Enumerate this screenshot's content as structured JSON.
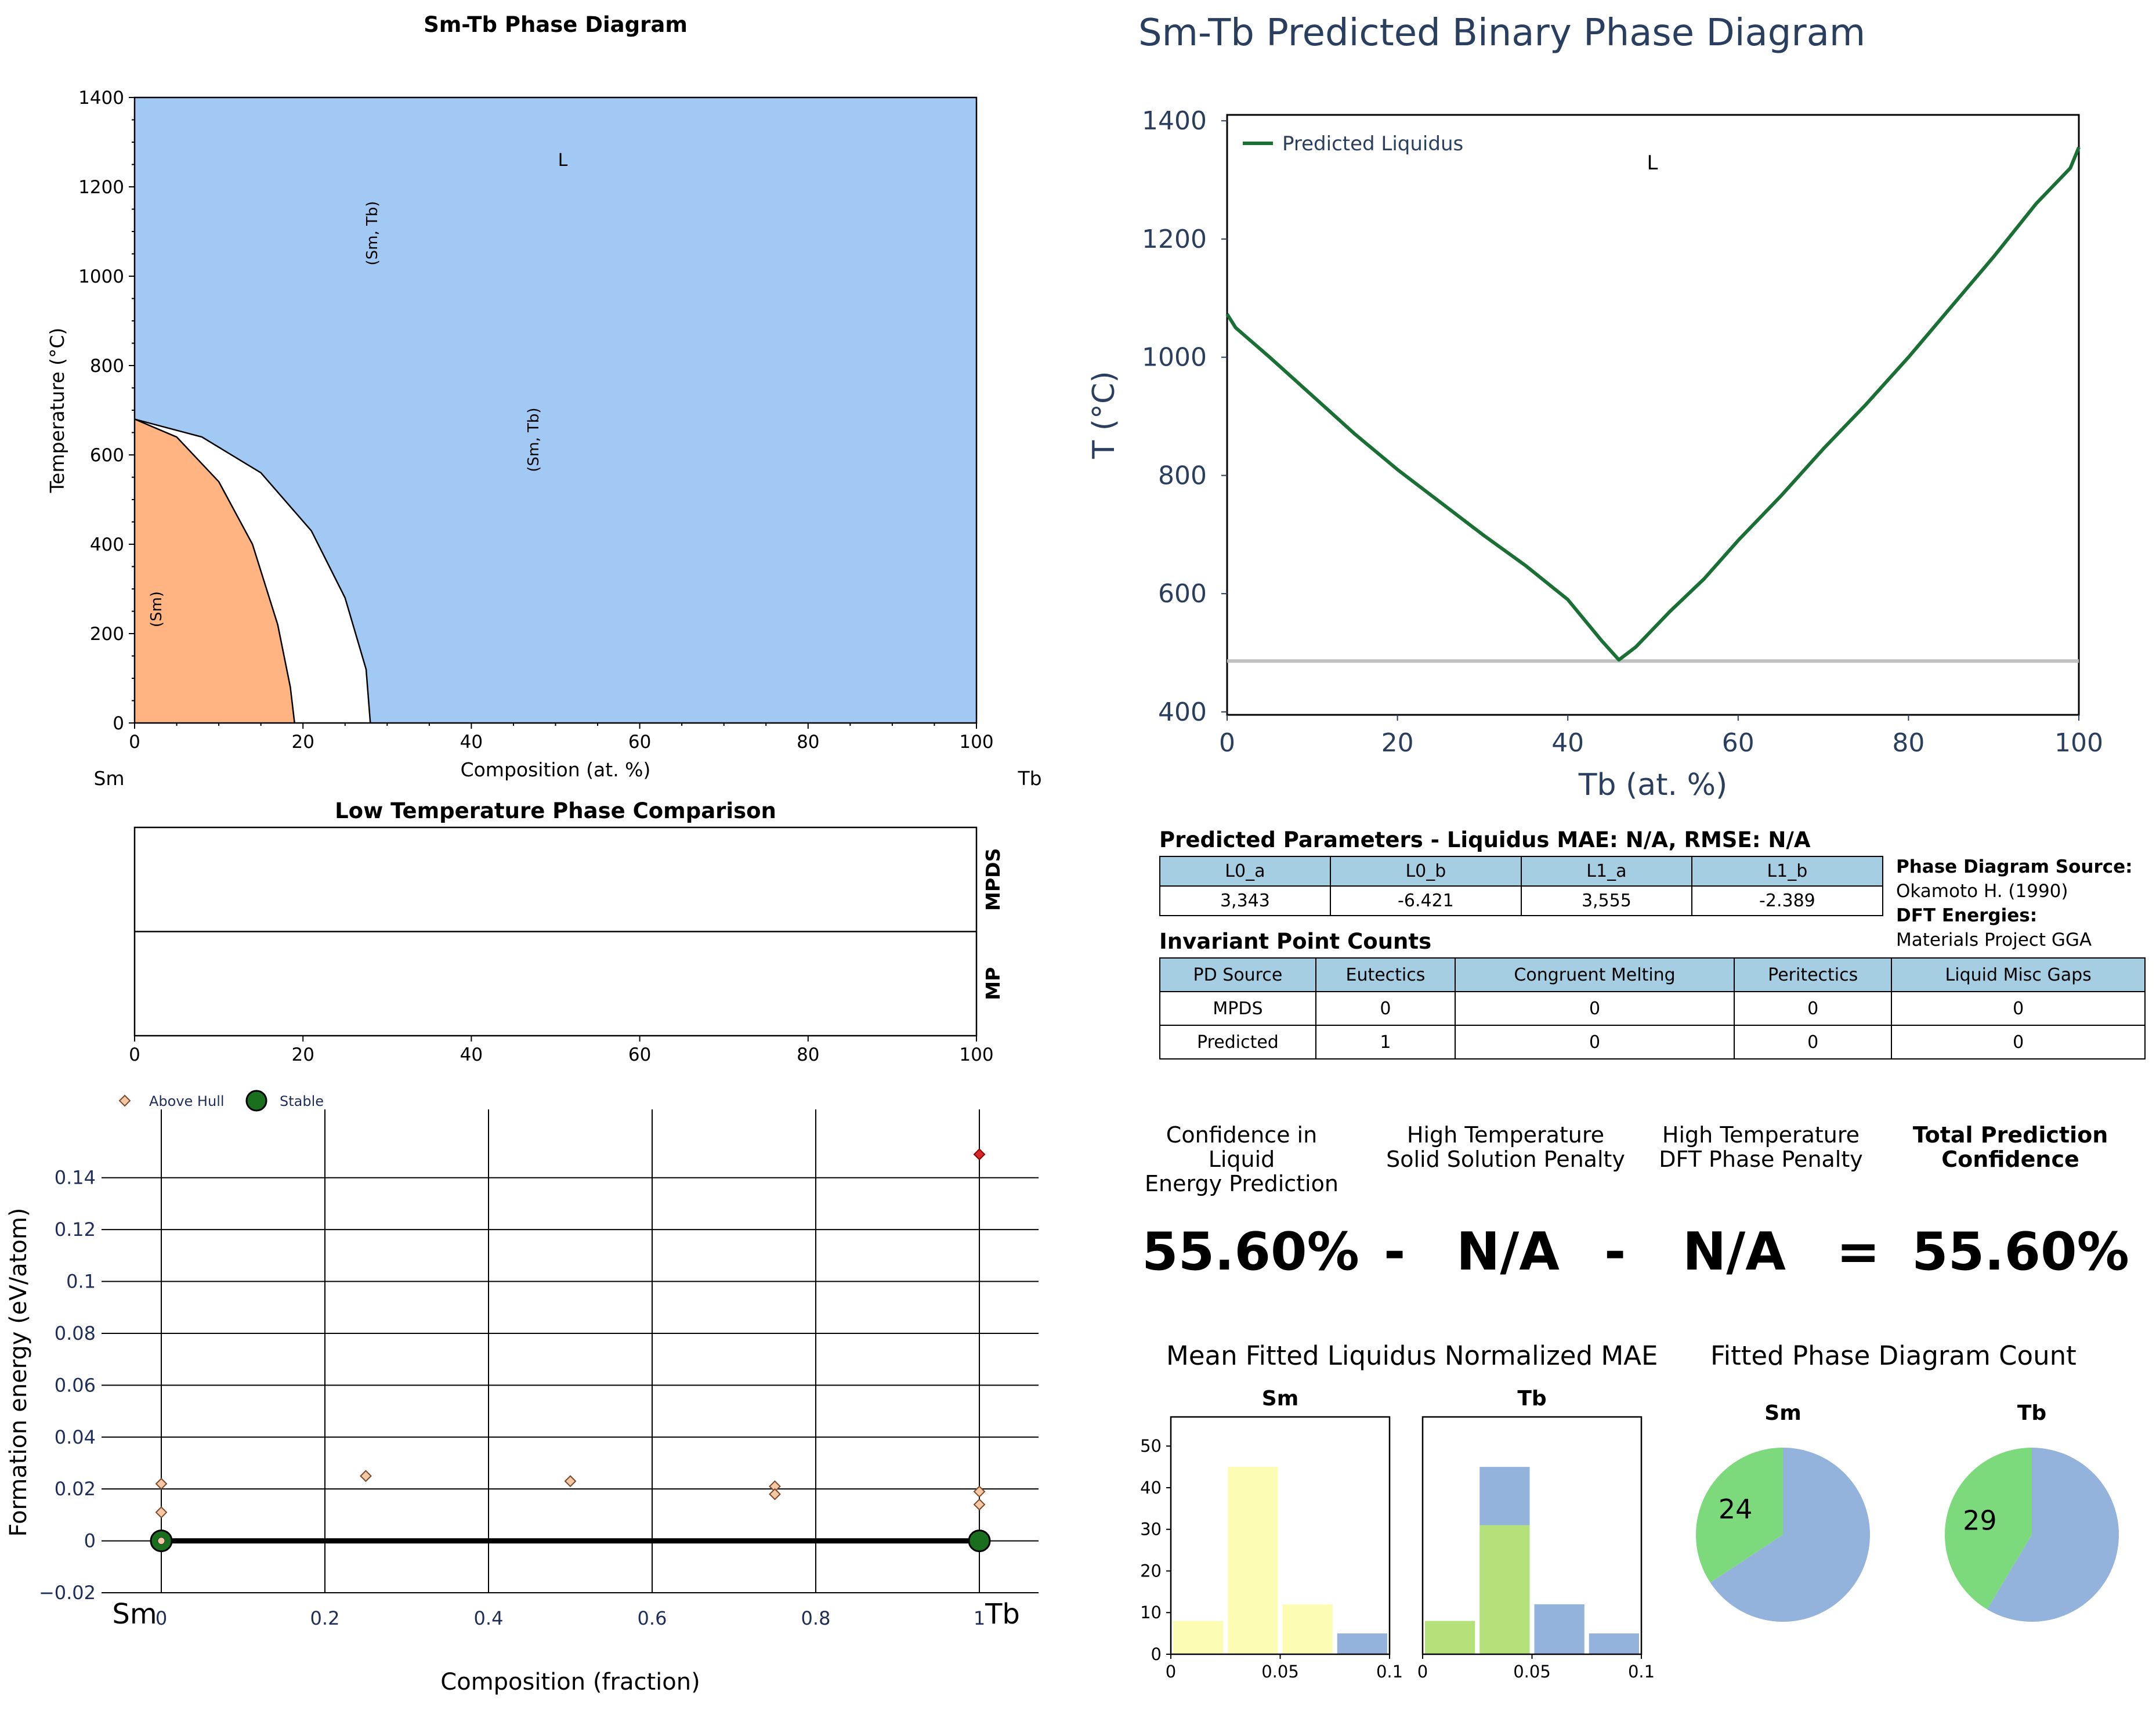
{
  "chart_data": [
    {
      "type": "area",
      "title": "Sm-Tb Phase Diagram",
      "xlabel": "Composition (at. %)",
      "ylabel": "Temperature (°C)",
      "xlim": [
        0,
        100
      ],
      "ylim": [
        0,
        1400
      ],
      "x_ticks": [
        "0",
        "20",
        "40",
        "60",
        "80",
        "100"
      ],
      "y_ticks": [
        "0",
        "200",
        "400",
        "600",
        "800",
        "1000",
        "1200",
        "1400"
      ],
      "left_element": "Sm",
      "right_element": "Tb",
      "regions": [
        {
          "label": "L",
          "color": "#a1c9f4"
        },
        {
          "label": "(Sm, Tb)",
          "color": "#a1c9f4"
        },
        {
          "label": "(Sm, Tb)",
          "color": "#a1c9f4"
        },
        {
          "label": "(Sm)",
          "color": "#ffb482"
        }
      ],
      "boundaries": [
        {
          "name": "solvus-1",
          "points": [
            [
              0,
              680
            ],
            [
              5,
              640
            ],
            [
              10,
              540
            ],
            [
              14,
              400
            ],
            [
              17,
              220
            ],
            [
              18.5,
              80
            ],
            [
              19,
              0
            ]
          ]
        },
        {
          "name": "solvus-2",
          "points": [
            [
              0,
              680
            ],
            [
              8,
              640
            ],
            [
              15,
              560
            ],
            [
              21,
              430
            ],
            [
              25,
              280
            ],
            [
              27.5,
              120
            ],
            [
              28,
              0
            ]
          ]
        }
      ]
    },
    {
      "type": "bar",
      "title": "Low Temperature Phase Comparison",
      "rows": [
        "MPDS",
        "MP"
      ],
      "xlim": [
        0,
        100
      ],
      "x_ticks": [
        "0",
        "20",
        "40",
        "60",
        "80",
        "100"
      ]
    },
    {
      "type": "scatter",
      "xlabel": "Composition (fraction)",
      "ylabel": "Formation energy (eV/atom)",
      "xlim": [
        0,
        1
      ],
      "ylim": [
        -0.02,
        0.15
      ],
      "x_ticks": [
        "0",
        "0.2",
        "0.4",
        "0.6",
        "0.8",
        "1"
      ],
      "y_ticks": [
        "−0.02",
        "0",
        "0.02",
        "0.04",
        "0.06",
        "0.08",
        "0.1",
        "0.12",
        "0.14"
      ],
      "left_element": "Sm",
      "right_element": "Tb",
      "legend": [
        {
          "name": "Above Hull"
        },
        {
          "name": "Stable"
        }
      ],
      "series": [
        {
          "name": "Above Hull",
          "color": "#f6c7a5",
          "points": [
            [
              0,
              0.022
            ],
            [
              0,
              0.011
            ],
            [
              0.25,
              0.025
            ],
            [
              0.5,
              0.023
            ],
            [
              0.75,
              0.021
            ],
            [
              0.75,
              0.018
            ],
            [
              1,
              0.019
            ],
            [
              1,
              0.014
            ],
            [
              1,
              0.149
            ]
          ]
        },
        {
          "name": "Stable",
          "color": "#1a6f1f",
          "points": [
            [
              0,
              0
            ],
            [
              1,
              0
            ]
          ]
        }
      ],
      "hull": [
        [
          0,
          0
        ],
        [
          1,
          0
        ]
      ]
    },
    {
      "type": "line",
      "title": "Sm-Tb Predicted Binary Phase Diagram",
      "xlabel": "Tb (at. %)",
      "ylabel": "T (°C)",
      "xlim": [
        0,
        100
      ],
      "ylim": [
        395,
        1410
      ],
      "x_ticks": [
        "0",
        "20",
        "40",
        "60",
        "80",
        "100"
      ],
      "y_ticks": [
        "400",
        "600",
        "800",
        "1000",
        "1200",
        "1400"
      ],
      "annotation": "L",
      "series": [
        {
          "name": "Predicted Liquidus",
          "color": "#1a6f35",
          "x": [
            0,
            1,
            5,
            10,
            15,
            20,
            25,
            30,
            35,
            40,
            44,
            46,
            48,
            52,
            56,
            60,
            65,
            70,
            75,
            80,
            85,
            90,
            95,
            99,
            100
          ],
          "y": [
            1073,
            1050,
            1000,
            935,
            870,
            810,
            755,
            700,
            648,
            590,
            520,
            488,
            510,
            570,
            625,
            690,
            765,
            845,
            920,
            1000,
            1085,
            1170,
            1260,
            1320,
            1355
          ]
        },
        {
          "name": "eutectic",
          "color": "#c0c0c0",
          "x": [
            0,
            100
          ],
          "y": [
            486,
            486
          ]
        }
      ]
    },
    {
      "type": "bar",
      "title": "Sm",
      "group_title": "Mean Fitted Liquidus Normalized MAE",
      "xlim": [
        0,
        0.1
      ],
      "ylim": [
        0,
        57
      ],
      "x_ticks": [
        "0",
        "0.05",
        "0.1"
      ],
      "y_ticks": [
        "0",
        "10",
        "20",
        "30",
        "40",
        "50"
      ],
      "bars": [
        {
          "x0": 0,
          "x1": 0.025,
          "value": 8,
          "color": "#fcfcb4"
        },
        {
          "x0": 0.025,
          "x1": 0.05,
          "value": 45,
          "color": "#fcfcb4"
        },
        {
          "x0": 0.05,
          "x1": 0.075,
          "value": 12,
          "color": "#fcfcb4"
        },
        {
          "x0": 0.075,
          "x1": 0.1,
          "value": 5,
          "color": "#93b2dc"
        }
      ]
    },
    {
      "type": "bar",
      "title": "Tb",
      "xlim": [
        0,
        0.1
      ],
      "ylim": [
        0,
        57
      ],
      "x_ticks": [
        "0",
        "0.05",
        "0.1"
      ],
      "bars": [
        {
          "x0": 0,
          "x1": 0.025,
          "value": 8,
          "color": "#b4e17a"
        },
        {
          "x0": 0.025,
          "x1": 0.05,
          "value": 31,
          "color": "#b4e17a"
        },
        {
          "x0": 0.025,
          "x1": 0.05,
          "value": 14,
          "stack_on": 31,
          "color": "#93b2dc"
        },
        {
          "x0": 0.05,
          "x1": 0.075,
          "value": 12,
          "color": "#93b2dc"
        },
        {
          "x0": 0.075,
          "x1": 0.1,
          "value": 5,
          "color": "#93b2dc"
        }
      ]
    },
    {
      "type": "pie",
      "title": "Sm",
      "group_title": "Fitted Phase Diagram Count",
      "label": "24",
      "slices": [
        {
          "value": 24,
          "color": "#7cd97c"
        },
        {
          "value": 46,
          "color": "#93b2dc"
        }
      ]
    },
    {
      "type": "pie",
      "title": "Tb",
      "label": "29",
      "slices": [
        {
          "value": 29,
          "color": "#7cd97c"
        },
        {
          "value": 41,
          "color": "#93b2dc"
        }
      ]
    }
  ],
  "parameters": {
    "title": "Predicted Parameters - Liquidus MAE: N/A, RMSE: N/A",
    "headers": [
      "L0_a",
      "L0_b",
      "L1_a",
      "L1_b"
    ],
    "values": [
      "3,343",
      "-6.421",
      "3,555",
      "-2.389"
    ]
  },
  "invariants": {
    "title": "Invariant Point Counts",
    "headers": [
      "PD Source",
      "Eutectics",
      "Congruent Melting",
      "Peritectics",
      "Liquid Misc Gaps"
    ],
    "rows": [
      [
        "MPDS",
        "0",
        "0",
        "0",
        "0"
      ],
      [
        "Predicted",
        "1",
        "0",
        "0",
        "0"
      ]
    ]
  },
  "sources": {
    "pd_label": "Phase Diagram Source:",
    "pd_value": "Okamoto H. (1990)",
    "dft_label": "DFT Energies:",
    "dft_value": "Materials Project GGA"
  },
  "confidence": {
    "labels": [
      "Confidence in Liquid\nEnergy Prediction",
      "High Temperature\nSolid Solution Penalty",
      "High Temperature\nDFT Phase Penalty",
      "Total Prediction\nConfidence"
    ],
    "values": [
      "55.60%",
      "N/A",
      "N/A",
      "55.60%"
    ],
    "ops": [
      "-",
      "-",
      "="
    ]
  }
}
